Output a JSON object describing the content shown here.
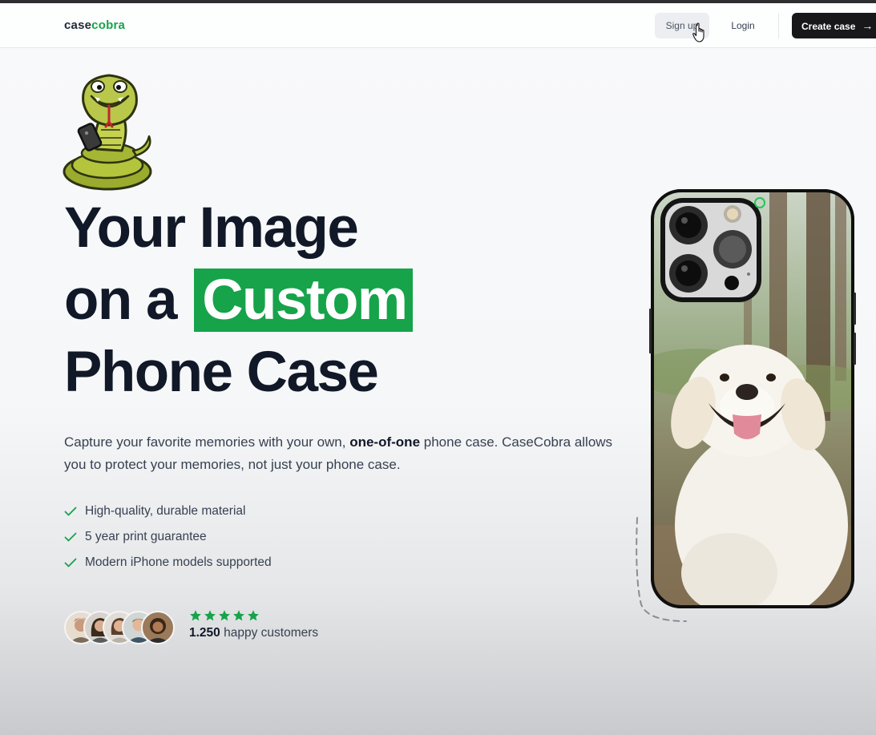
{
  "navbar": {
    "logo_prefix": "case",
    "logo_accent": "cobra",
    "signup_label": "Sign up",
    "login_label": "Login",
    "create_label": "Create case",
    "create_arrow": "→"
  },
  "hero": {
    "headline_line1": "Your Image",
    "headline_line2_prefix": "on a",
    "headline_highlight": "Custom",
    "headline_line3": "Phone Case",
    "subtext_part1": "Capture your favorite memories with your own, ",
    "subtext_bold": "one-of-one",
    "subtext_part2": " phone case. CaseCobra allows you to protect your memories, not just your phone case.",
    "features": [
      "High-quality, durable material",
      "5 year print guarantee",
      "Modern iPhone models supported"
    ],
    "rating_stars": 5,
    "customers_count": "1.250",
    "customers_label": " happy customers"
  },
  "colors": {
    "brand_green": "#16a34a",
    "dark": "#18181b"
  },
  "icons": {
    "check": "check-icon",
    "star": "star-icon",
    "arrow": "arrow-right-icon",
    "cursor": "hand-pointer-icon"
  }
}
